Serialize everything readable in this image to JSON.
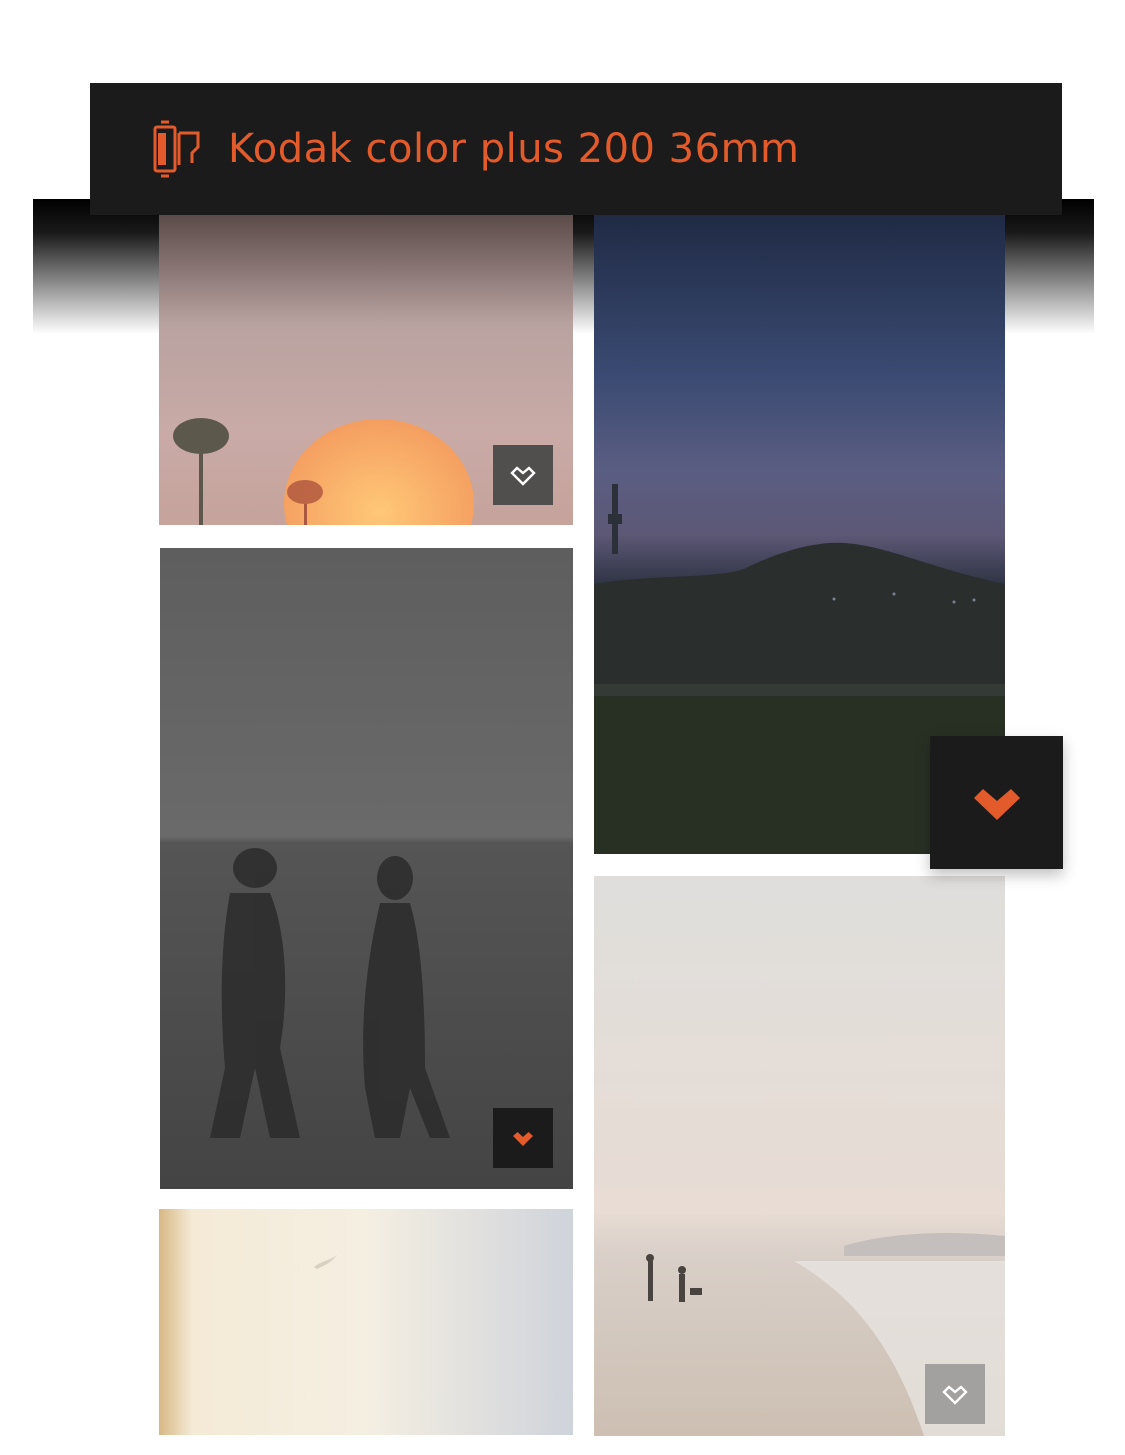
{
  "header": {
    "title": "Kodak color plus 200 36mm",
    "icon": "film-roll-icon",
    "accent_color": "#e35b2a",
    "background_color": "#1c1b1b"
  },
  "photos": [
    {
      "name": "sunset-palm-photo",
      "liked": false
    },
    {
      "name": "night-city-hill-photo",
      "liked": true
    },
    {
      "name": "couple-walking-beach-photo",
      "liked": true
    },
    {
      "name": "misty-beach-photo",
      "liked": false
    },
    {
      "name": "bright-sky-bird-photo",
      "liked": false
    }
  ],
  "icons": {
    "like_outline": "heart-outline-icon",
    "like_filled": "heart-filled-icon"
  }
}
